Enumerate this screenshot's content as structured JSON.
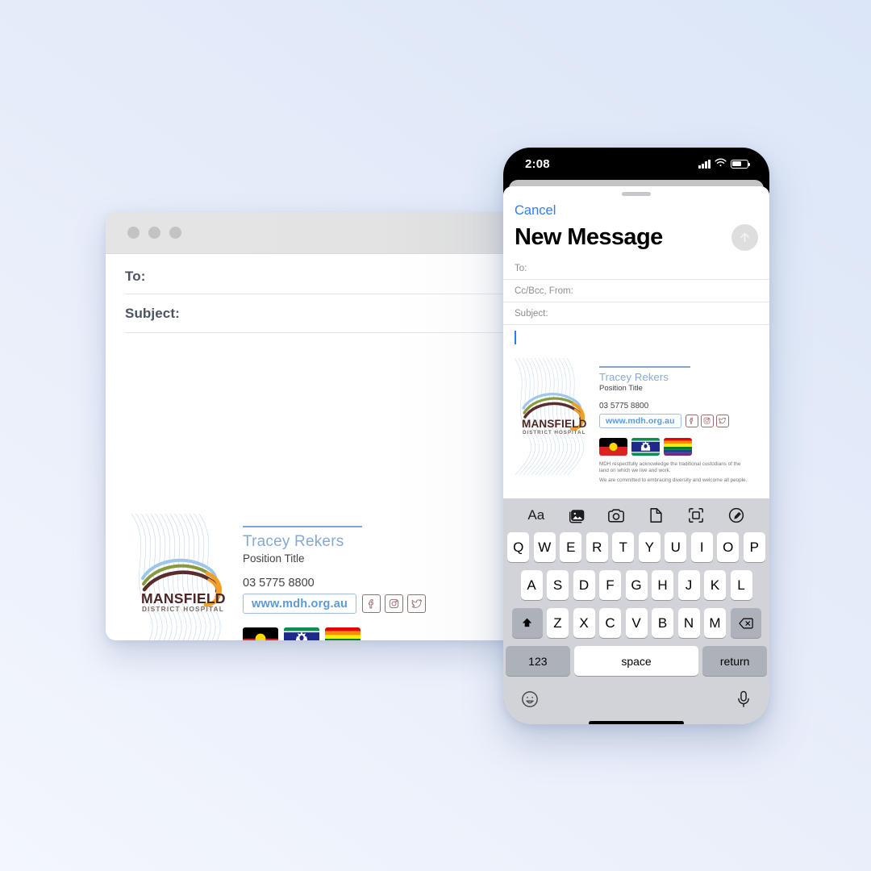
{
  "background": {
    "gradient_from": "#dbe6f8",
    "gradient_to": "#f3f6fd"
  },
  "desktop_window": {
    "traffic_lights": [
      "close",
      "minimize",
      "zoom"
    ],
    "fields": [
      {
        "label": "To:",
        "value": ""
      },
      {
        "label": "Subject:",
        "value": ""
      }
    ]
  },
  "phone": {
    "status_bar": {
      "time": "2:08",
      "cellular": "signal-bars",
      "wifi": "wifi-icon",
      "battery": "battery-icon"
    },
    "sheet": {
      "cancel_label": "Cancel",
      "title": "New Message",
      "send_icon": "arrow-up-icon",
      "fields": [
        {
          "label": "To:",
          "value": ""
        },
        {
          "label": "Cc/Bcc, From:",
          "value": ""
        },
        {
          "label": "Subject:",
          "value": ""
        }
      ]
    },
    "keyboard": {
      "toolbar": [
        "Aa",
        "photos-icon",
        "camera-icon",
        "document-icon",
        "scan-icon",
        "markup-icon"
      ],
      "row1": [
        "Q",
        "W",
        "E",
        "R",
        "T",
        "Y",
        "U",
        "I",
        "O",
        "P"
      ],
      "row2": [
        "A",
        "S",
        "D",
        "F",
        "G",
        "H",
        "J",
        "K",
        "L"
      ],
      "row3": [
        "Z",
        "X",
        "C",
        "V",
        "B",
        "N",
        "M"
      ],
      "shift_label": "shift-icon",
      "backspace_label": "backspace-icon",
      "numbers_label": "123",
      "space_label": "space",
      "return_label": "return",
      "emoji_label": "emoji-icon",
      "dictation_label": "microphone-icon"
    }
  },
  "signature": {
    "logo": {
      "name_line1": "MANSFIELD",
      "name_line2": "DISTRICT HOSPITAL",
      "colors": {
        "blue": "#9dc6e8",
        "green": "#8a9a3b",
        "brown": "#5a2d2a",
        "orange": "#f0a02a",
        "text": "#4a2725"
      }
    },
    "name": "Tracey Rekers",
    "position": "Position Title",
    "phone": "03 5775 8800",
    "website": "www.mdh.org.au",
    "socials": [
      "facebook-icon",
      "instagram-icon",
      "twitter-icon"
    ],
    "flags": [
      "aboriginal-flag",
      "torres-strait-islander-flag",
      "pride-flag"
    ],
    "acknowledgement_line1": "MDH respectfully acknowledge the traditional custodians of the land on which we live and work.",
    "acknowledgement_line2": "We are committed to embracing diversity and welcome all people.",
    "colors": {
      "name": "#86a9d4",
      "rule": "#7fa6d8",
      "url": "#5b9bd5",
      "url_border": "#9dbfe4",
      "social_border": "#9b6e6e",
      "ack_text": "#6f7479"
    }
  }
}
